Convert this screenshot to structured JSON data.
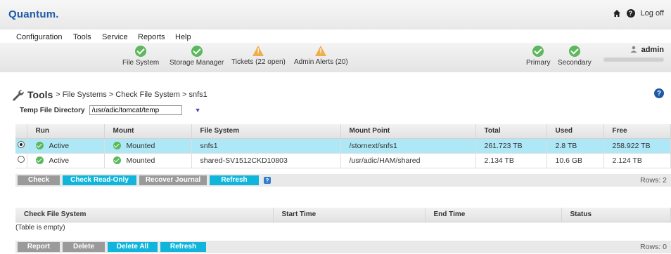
{
  "header": {
    "logo": "Quantum.",
    "logoff": "Log off"
  },
  "menu": [
    "Configuration",
    "Tools",
    "Service",
    "Reports",
    "Help"
  ],
  "status": {
    "file_system": "File System",
    "storage_manager": "Storage Manager",
    "tickets": "Tickets (22 open)",
    "admin_alerts": "Admin Alerts (20)",
    "primary": "Primary",
    "secondary": "Secondary",
    "user": "admin"
  },
  "breadcrumb": {
    "tools": "Tools",
    "path": "> File Systems > Check File System > snfs1"
  },
  "temp_dir": {
    "label": "Temp File Directory",
    "value": "/usr/adic/tomcat/temp"
  },
  "fs_table": {
    "headers": [
      "Run",
      "Mount",
      "File System",
      "Mount Point",
      "Total",
      "Used",
      "Free"
    ],
    "rows": [
      {
        "selected": true,
        "run": "Active",
        "mount": "Mounted",
        "fs": "snfs1",
        "mp": "/stornext/snfs1",
        "total": "261.723 TB",
        "used": "2.8 TB",
        "free": "258.922 TB"
      },
      {
        "selected": false,
        "run": "Active",
        "mount": "Mounted",
        "fs": "shared-SV1512CKD10803",
        "mp": "/usr/adic/HAM/shared",
        "total": "2.134 TB",
        "used": "10.6 GB",
        "free": "2.124 TB"
      }
    ],
    "buttons": {
      "check": "Check",
      "check_ro": "Check Read-Only",
      "recover": "Recover Journal",
      "refresh": "Refresh"
    },
    "rows_label": "Rows: 2"
  },
  "job_table": {
    "headers": [
      "Check File System",
      "Start Time",
      "End Time",
      "Status"
    ],
    "empty": "(Table is empty)",
    "buttons": {
      "report": "Report",
      "delete": "Delete",
      "delete_all": "Delete All",
      "refresh": "Refresh"
    },
    "rows_label": "Rows: 0"
  },
  "colors": {
    "brand": "#1f5aa6",
    "accent": "#11b5dc",
    "selected_row": "#aee7f5",
    "ok": "#5cb85c",
    "warn": "#f0ad4e"
  }
}
